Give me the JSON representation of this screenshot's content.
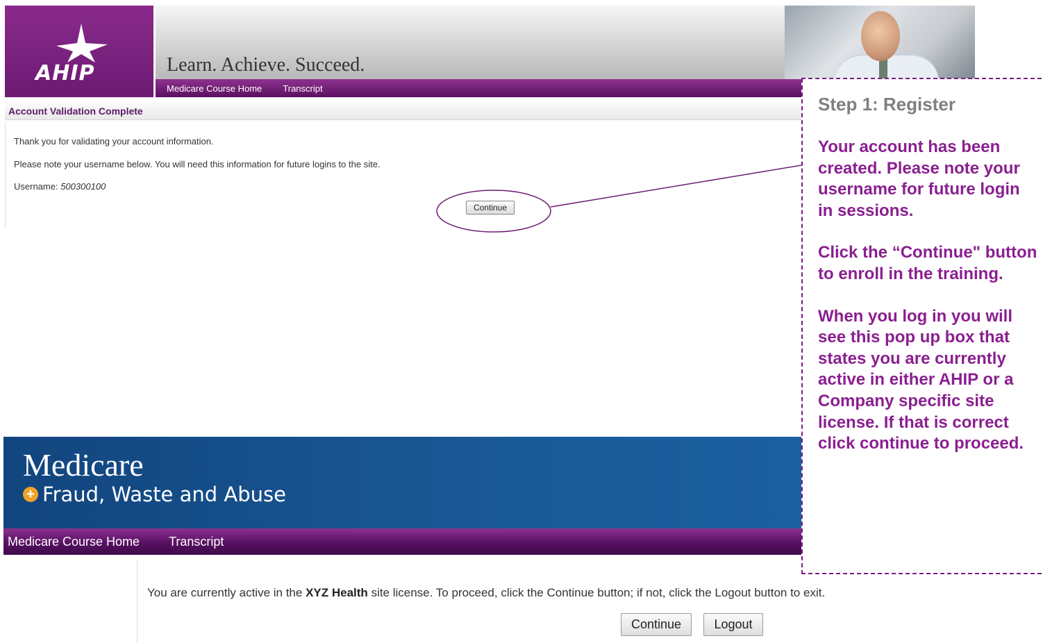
{
  "top": {
    "logo_text": "AHIP",
    "tagline": "Learn. Achieve. Succeed.",
    "nav": [
      "Medicare Course Home",
      "Transcript"
    ],
    "section_title": "Account Validation Complete",
    "thanks": "Thank you for validating your account information.",
    "note": "Please note your username below. You will need this information for future logins to the site.",
    "username_label": "Username: ",
    "username_value": "500300100",
    "continue_label": "Continue"
  },
  "callout": {
    "step": "Step 1: Register",
    "para1": "Your account has been created. Please note your username for future login in sessions.",
    "para2": "Click the “Continue\" button to enroll in the training.",
    "para3": "When you log in you will see this pop up box that states you are currently active in either AHIP or a Company specific site license. If that is correct click continue to proceed."
  },
  "bottom": {
    "title": "Medicare",
    "subtitle": "Fraud, Waste and Abuse",
    "nav": [
      "Medicare Course Home",
      "Transcript"
    ],
    "msg_before": "You are currently active in the ",
    "msg_bold": "XYZ Health",
    "msg_after": " site license. To proceed, click the Continue button; if not, click the Logout button to exit.",
    "continue_label": "Continue",
    "logout_label": "Logout"
  },
  "colors": {
    "purple": "#6c1a72",
    "callout_text": "#8a1f90",
    "medicare_blue": "#1a5a98"
  }
}
